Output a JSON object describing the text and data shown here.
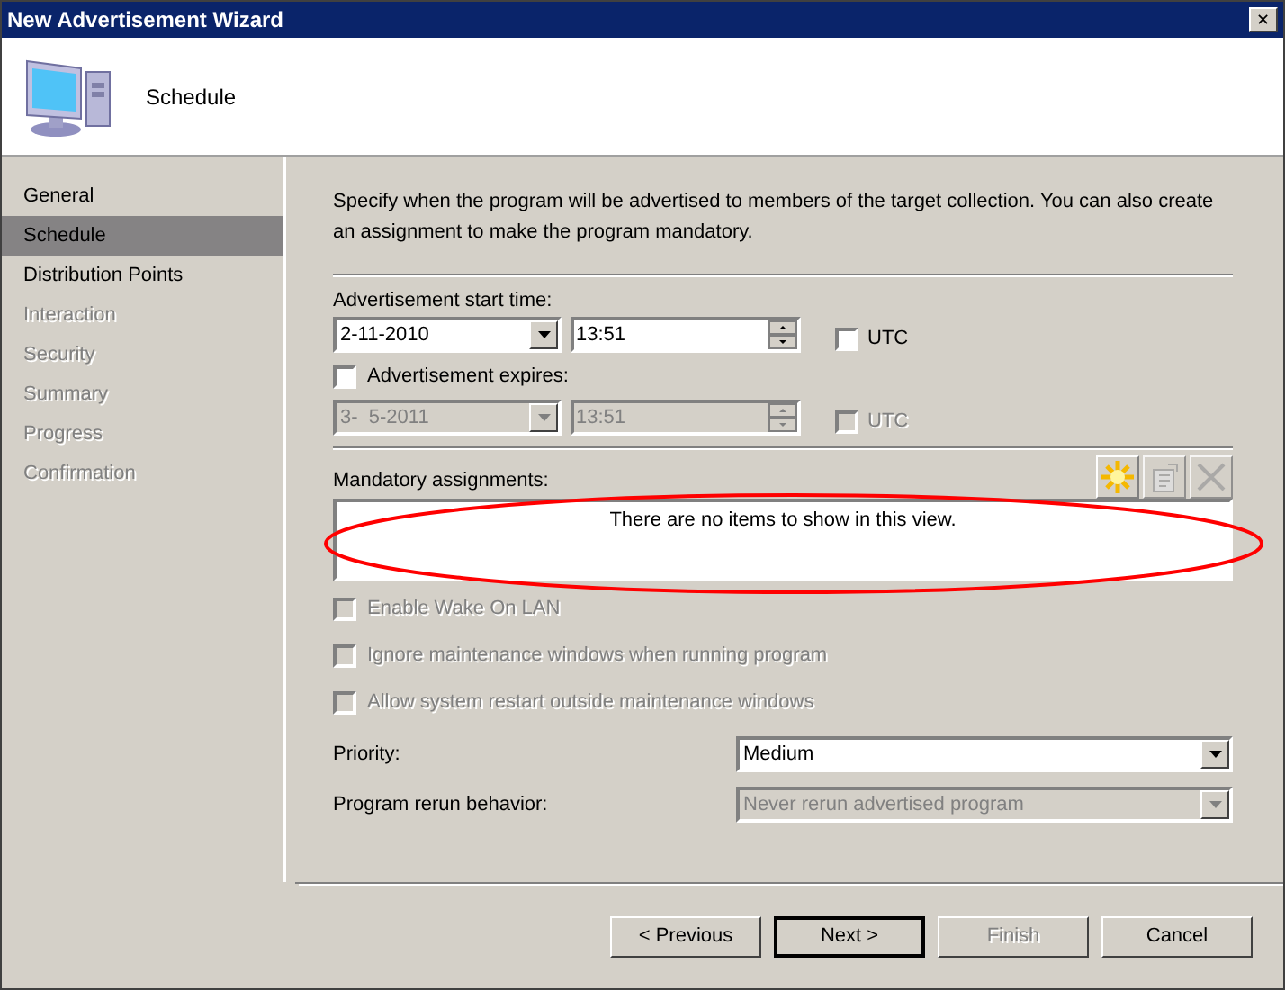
{
  "window": {
    "title": "New Advertisement Wizard",
    "close": "✕"
  },
  "header": {
    "title": "Schedule"
  },
  "sidebar": {
    "items": [
      {
        "label": "General",
        "selected": false,
        "disabled": false
      },
      {
        "label": "Schedule",
        "selected": true,
        "disabled": false
      },
      {
        "label": "Distribution Points",
        "selected": false,
        "disabled": false
      },
      {
        "label": "Interaction",
        "selected": false,
        "disabled": true
      },
      {
        "label": "Security",
        "selected": false,
        "disabled": true
      },
      {
        "label": "Summary",
        "selected": false,
        "disabled": true
      },
      {
        "label": "Progress",
        "selected": false,
        "disabled": true
      },
      {
        "label": "Confirmation",
        "selected": false,
        "disabled": true
      }
    ]
  },
  "description": "Specify when the program will be advertised to members of the target collection. You can also create an assignment to make the program mandatory.",
  "start": {
    "label": "Advertisement start time:",
    "date": "2-11-2010",
    "time": "13:51",
    "utc": {
      "label": "UTC",
      "checked": false,
      "disabled": false
    }
  },
  "expires": {
    "label": "Advertisement expires:",
    "checked": false,
    "date": "3-  5-2011",
    "time": "13:51",
    "disabled": true,
    "utc": {
      "label": "UTC",
      "checked": false,
      "disabled": true
    }
  },
  "mandatory": {
    "label": "Mandatory assignments:",
    "empty_text": "There are no items to show in this view.",
    "toolbar": [
      {
        "kind": "new",
        "disabled": false
      },
      {
        "kind": "properties",
        "disabled": true
      },
      {
        "kind": "delete",
        "disabled": true
      }
    ]
  },
  "options": [
    {
      "label": "Enable Wake On LAN",
      "checked": false,
      "disabled": true
    },
    {
      "label": "Ignore maintenance windows when running program",
      "checked": false,
      "disabled": true
    },
    {
      "label": "Allow system restart outside maintenance windows",
      "checked": false,
      "disabled": true
    }
  ],
  "priority": {
    "label": "Priority:",
    "value": "Medium",
    "disabled": false
  },
  "rerun": {
    "label": "Program rerun behavior:",
    "value": "Never rerun advertised program",
    "disabled": true
  },
  "buttons": [
    {
      "label": "< Previous",
      "disabled": false,
      "default": false
    },
    {
      "label": "Next >",
      "disabled": false,
      "default": true
    },
    {
      "label": "Finish",
      "disabled": true,
      "default": false
    },
    {
      "label": "Cancel",
      "disabled": false,
      "default": false
    }
  ]
}
